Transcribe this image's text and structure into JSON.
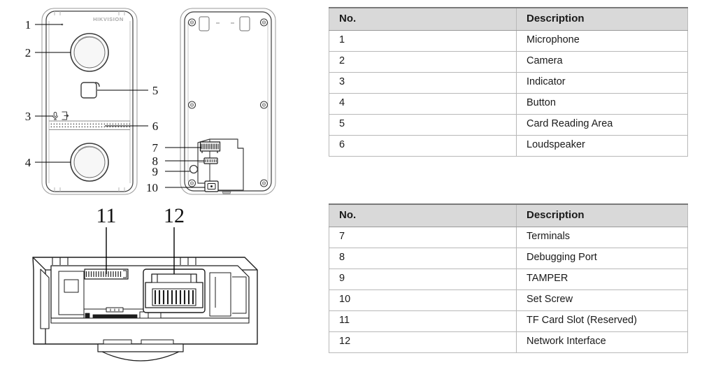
{
  "diagram": {
    "brand_logo": "HIKVISION",
    "views": {
      "front": {
        "name": "front-view",
        "callouts": [
          "1",
          "2",
          "3",
          "4",
          "5",
          "6"
        ]
      },
      "rear": {
        "name": "rear-view",
        "callouts": [
          "7",
          "8",
          "9",
          "10"
        ]
      },
      "bottom": {
        "name": "bottom-view",
        "callouts": [
          "11",
          "12"
        ]
      }
    },
    "callout_labels": {
      "c1": "1",
      "c2": "2",
      "c3": "3",
      "c4": "4",
      "c5": "5",
      "c6": "6",
      "c7": "7",
      "c8": "8",
      "c9": "9",
      "c10": "10",
      "c11": "11",
      "c12": "12"
    },
    "icons": {
      "microphone": "microphone-icon",
      "door_exit": "door-exit-icon"
    },
    "colors": {
      "outline": "#3c3c3c",
      "light_outline": "#9a9a9a",
      "logo_gray": "#a8a8a8",
      "leader_line": "#000000"
    }
  },
  "tables": [
    {
      "id": "legend-table-1",
      "headers": [
        "No.",
        "Description"
      ],
      "rows": [
        {
          "no": "1",
          "description": "Microphone"
        },
        {
          "no": "2",
          "description": "Camera"
        },
        {
          "no": "3",
          "description": "Indicator"
        },
        {
          "no": "4",
          "description": "Button"
        },
        {
          "no": "5",
          "description": "Card Reading Area"
        },
        {
          "no": "6",
          "description": "Loudspeaker"
        }
      ]
    },
    {
      "id": "legend-table-2",
      "headers": [
        "No.",
        "Description"
      ],
      "rows": [
        {
          "no": "7",
          "description": "Terminals"
        },
        {
          "no": "8",
          "description": "Debugging Port"
        },
        {
          "no": "9",
          "description": "TAMPER"
        },
        {
          "no": "10",
          "description": "Set Screw"
        },
        {
          "no": "11",
          "description": "TF Card Slot (Reserved)"
        },
        {
          "no": "12",
          "description": "Network Interface"
        }
      ]
    }
  ],
  "style": {
    "header_bg": "#d9d9d9",
    "border_color": "#b8b8b8",
    "header_top_border": "#7a7a7a",
    "text_color": "#1a1a1a",
    "page_bg": "#ffffff"
  }
}
